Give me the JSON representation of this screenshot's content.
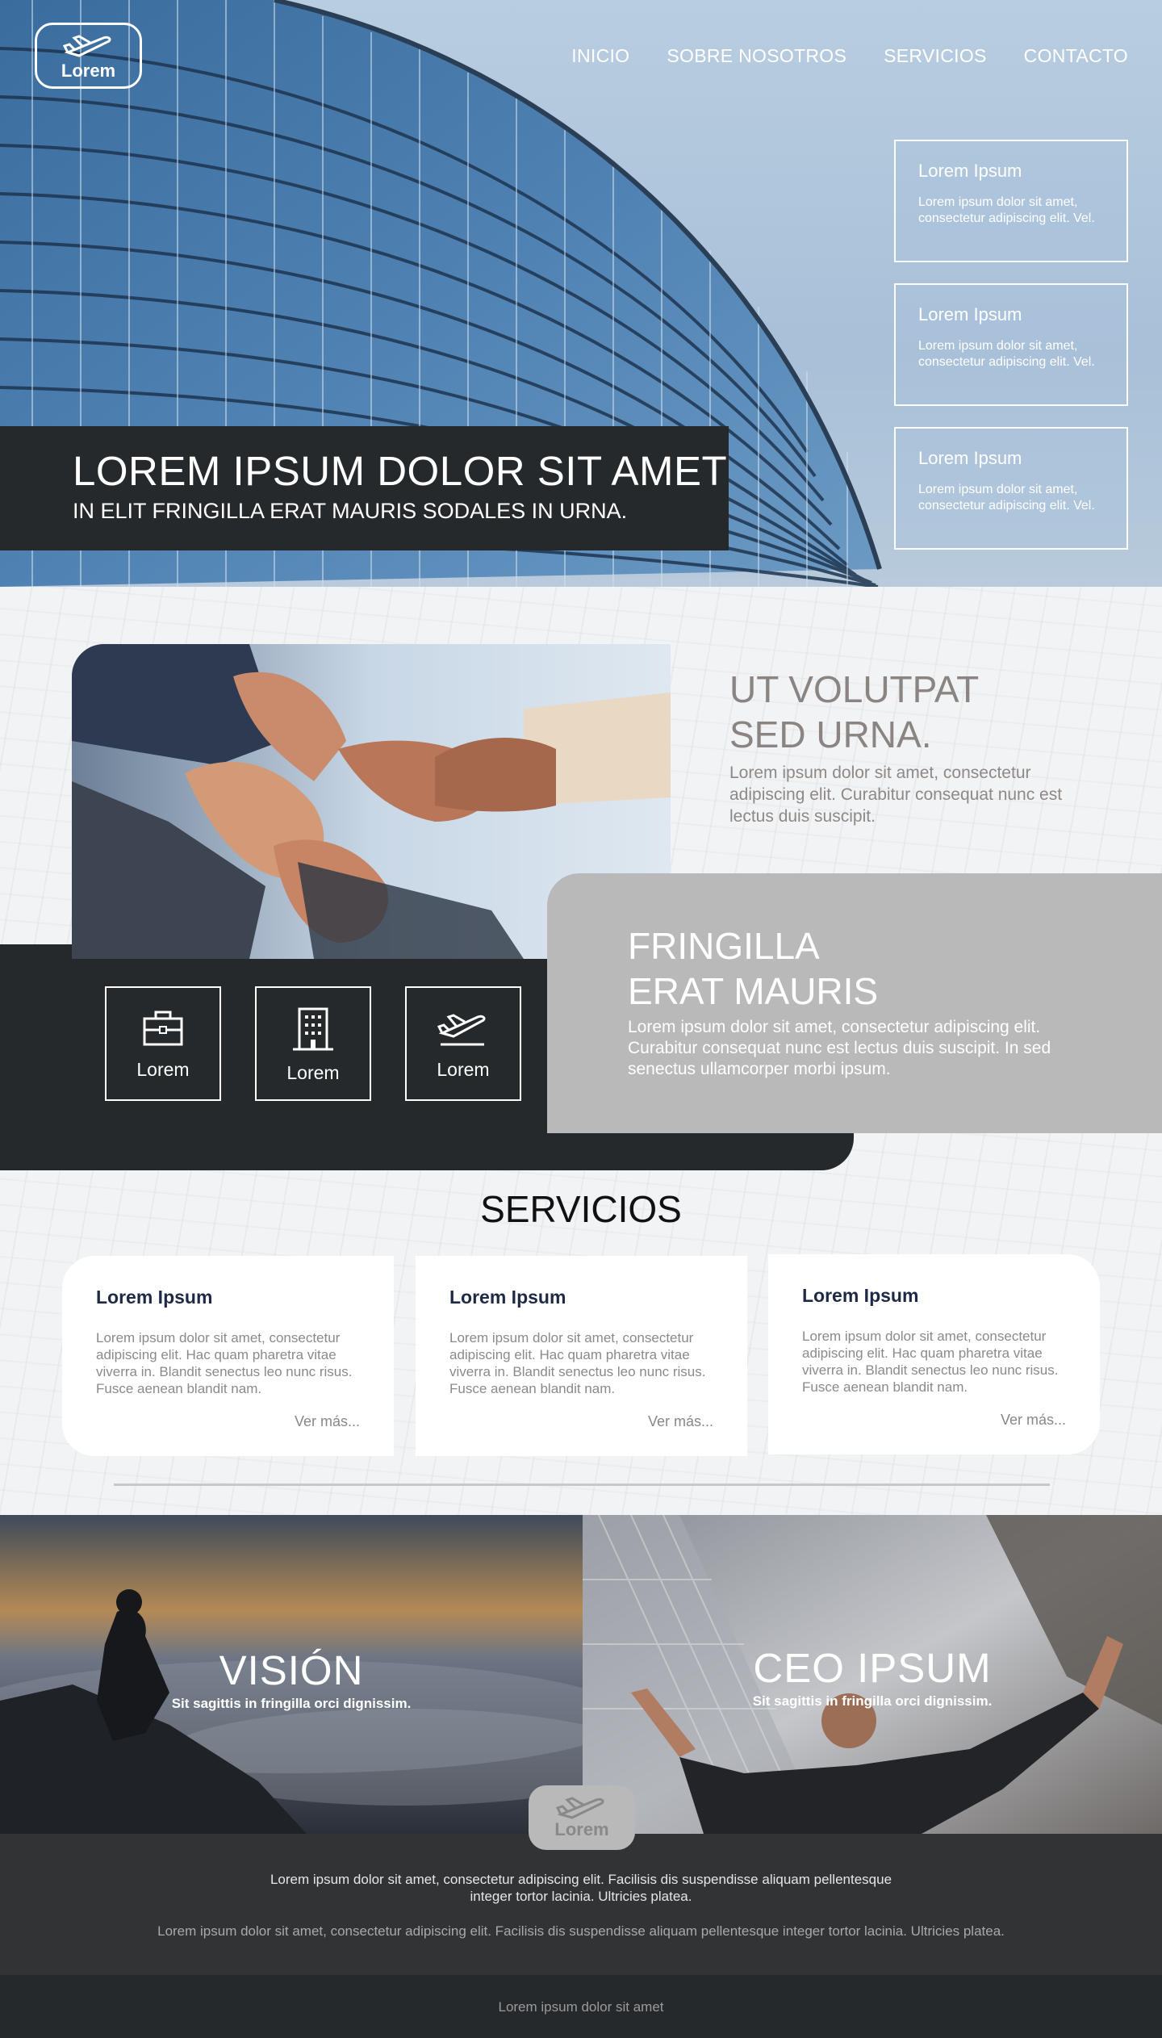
{
  "header": {
    "logo_text": "Lorem",
    "nav": [
      "INICIO",
      "SOBRE NOSOTROS",
      "SERVICIOS",
      "CONTACTO"
    ]
  },
  "hero": {
    "title": "LOREM IPSUM DOLOR SIT AMET",
    "subtitle": "IN ELIT FRINGILLA ERAT MAURIS SODALES IN URNA.",
    "cards": [
      {
        "title": "Lorem Ipsum",
        "text": "Lorem ipsum dolor sit amet, consectetur adipiscing elit. Vel."
      },
      {
        "title": "Lorem Ipsum",
        "text": "Lorem ipsum dolor sit amet, consectetur adipiscing elit. Vel."
      },
      {
        "title": "Lorem Ipsum",
        "text": "Lorem ipsum dolor sit amet, consectetur adipiscing elit. Vel."
      }
    ]
  },
  "about": {
    "title_line1": "UT VOLUTPAT",
    "title_line2": "SED URNA.",
    "text": "Lorem ipsum dolor sit amet, consectetur adipiscing elit. Curabitur consequat nunc est lectus duis suscipit."
  },
  "icons": [
    {
      "icon": "briefcase-icon",
      "label": "Lorem"
    },
    {
      "icon": "building-icon",
      "label": "Lorem"
    },
    {
      "icon": "plane-departure-icon",
      "label": "Lorem"
    }
  ],
  "feature": {
    "title_line1": "FRINGILLA",
    "title_line2": "ERAT MAURIS",
    "text": "Lorem ipsum dolor sit amet, consectetur adipiscing elit. Curabitur consequat nunc est lectus duis suscipit. In sed senectus ullamcorper morbi ipsum."
  },
  "services": {
    "title": "SERVICIOS",
    "cards": [
      {
        "title": "Lorem Ipsum",
        "text": "Lorem ipsum dolor sit amet, consectetur adipiscing elit. Hac quam pharetra vitae viverra in. Blandit senectus leo nunc risus. Fusce aenean blandit nam.",
        "link": "Ver más..."
      },
      {
        "title": "Lorem Ipsum",
        "text": "Lorem ipsum dolor sit amet, consectetur adipiscing elit. Hac quam pharetra vitae viverra in. Blandit senectus leo nunc risus. Fusce aenean blandit nam.",
        "link": "Ver más..."
      },
      {
        "title": "Lorem Ipsum",
        "text": "Lorem ipsum dolor sit amet, consectetur adipiscing elit. Hac quam pharetra vitae viverra in. Blandit senectus leo nunc risus. Fusce aenean blandit nam.",
        "link": "Ver más..."
      }
    ]
  },
  "vision": {
    "title": "VISIÓN",
    "text": "Sit sagittis in fringilla orci dignissim."
  },
  "ceo": {
    "title": "CEO IPSUM",
    "text": "Sit sagittis in fringilla orci dignissim."
  },
  "footer": {
    "logo_text": "Lorem",
    "text1": "Lorem ipsum dolor sit amet, consectetur adipiscing elit. Facilisis dis suspendisse aliquam pellentesque integer tortor lacinia. Ultricies platea.",
    "text2": "Lorem ipsum dolor sit amet, consectetur adipiscing elit. Facilisis dis suspendisse aliquam pellentesque integer tortor lacinia. Ultricies platea.",
    "bottom": "Lorem ipsum dolor sit amet"
  },
  "colors": {
    "dark": "#26292c",
    "grey_card": "#b9b9ba",
    "service_title": "#1e2a45",
    "muted_text": "#8a8583"
  }
}
